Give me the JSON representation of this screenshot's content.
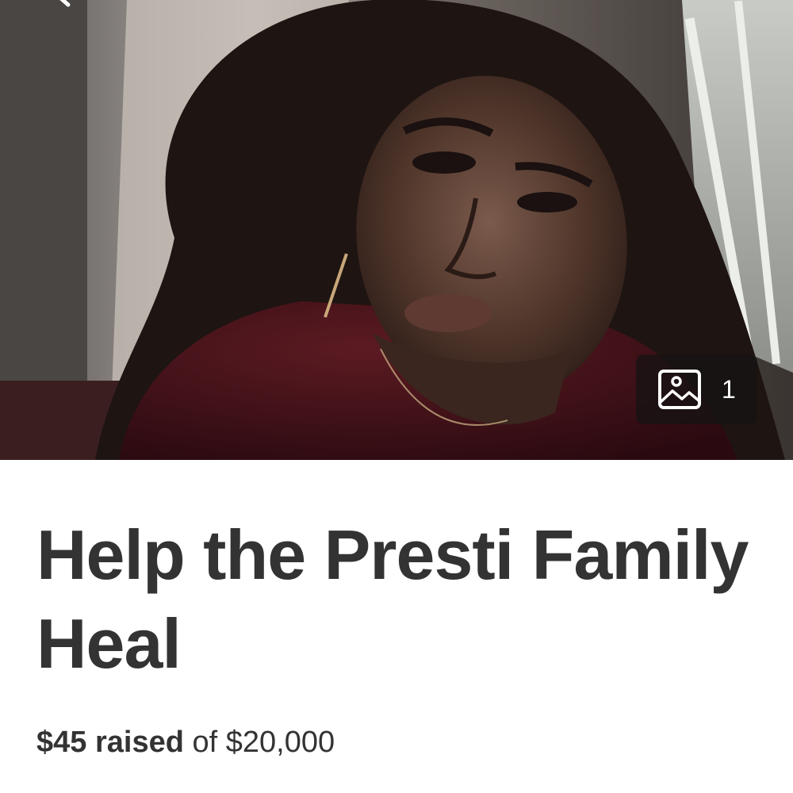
{
  "hero": {
    "photo_count": "1",
    "icons": {
      "back": "back-arrow-icon",
      "gallery": "image-gallery-icon"
    }
  },
  "campaign": {
    "title": "Help the Presti Family Heal",
    "raised_text": "$45 raised",
    "goal_text": " of $20,000",
    "raised_amount": 45,
    "goal_amount": 20000,
    "currency": "$"
  },
  "colors": {
    "title_text": "#333333",
    "badge_background": "#141414",
    "page_background": "#ffffff"
  }
}
